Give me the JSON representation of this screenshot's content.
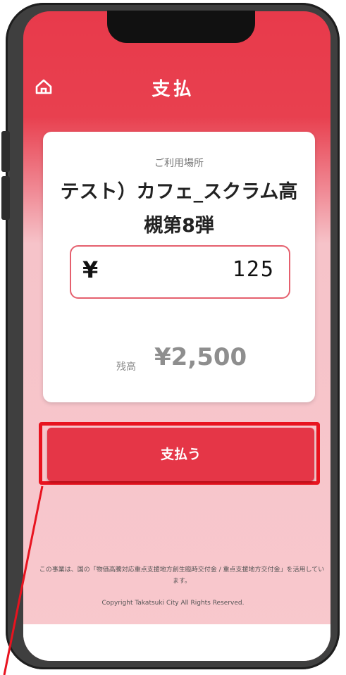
{
  "header": {
    "title": "支払",
    "home_icon": "home-icon"
  },
  "card": {
    "location_label": "ご利用場所",
    "store_name": "テスト）カフェ_スクラム高槻第8弾",
    "amount_currency": "¥",
    "amount_value": "125",
    "balance_label": "残高",
    "balance_value": "¥2,500"
  },
  "actions": {
    "pay_label": "支払う"
  },
  "footer": {
    "notice": "この事業は、国の「物価高騰対応重点支援地方創生臨時交付金 / 重点支援地方交付金」を活用しています。",
    "copyright": "Copyright Takatsuki City All Rights Reserved."
  },
  "colors": {
    "brand_red": "#e83a4b",
    "highlight_red": "#e8131f",
    "background_pink": "#f8c8cd"
  }
}
